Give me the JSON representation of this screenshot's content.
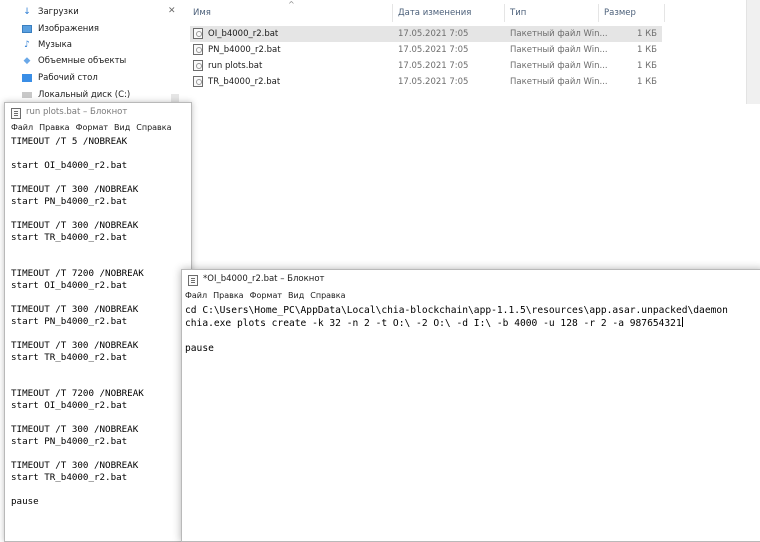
{
  "explorer": {
    "nav_items": [
      {
        "label": "Загрузки",
        "icon": "download-arrow-icon"
      },
      {
        "label": "Изображения",
        "icon": "pictures-icon"
      },
      {
        "label": "Музыка",
        "icon": "music-note-icon"
      },
      {
        "label": "Объемные объекты",
        "icon": "3d-objects-icon"
      },
      {
        "label": "Рабочий стол",
        "icon": "desktop-icon"
      },
      {
        "label": "Локальный диск (C:)",
        "icon": "drive-icon"
      }
    ],
    "columns": {
      "name": "Имя",
      "date": "Дата изменения",
      "type": "Тип",
      "size": "Размер"
    },
    "files": [
      {
        "name": "OI_b4000_r2.bat",
        "date": "17.05.2021 7:05",
        "type": "Пакетный файл Win...",
        "size": "1 КБ",
        "selected": true
      },
      {
        "name": "PN_b4000_r2.bat",
        "date": "17.05.2021 7:05",
        "type": "Пакетный файл Win...",
        "size": "1 КБ",
        "selected": false
      },
      {
        "name": "run plots.bat",
        "date": "17.05.2021 7:05",
        "type": "Пакетный файл Win...",
        "size": "1 КБ",
        "selected": false
      },
      {
        "name": "TR_b4000_r2.bat",
        "date": "17.05.2021 7:05",
        "type": "Пакетный файл Win...",
        "size": "1 КБ",
        "selected": false
      }
    ]
  },
  "notepad_menu": [
    "Файл",
    "Правка",
    "Формат",
    "Вид",
    "Справка"
  ],
  "notepad1": {
    "title": "run plots.bat – Блокнот",
    "lines": [
      "TIMEOUT /T 5 /NOBREAK",
      "",
      "start OI_b4000_r2.bat",
      "",
      "TIMEOUT /T 300 /NOBREAK",
      "start PN_b4000_r2.bat",
      "",
      "TIMEOUT /T 300 /NOBREAK",
      "start TR_b4000_r2.bat",
      "",
      "",
      "TIMEOUT /T 7200 /NOBREAK",
      "start OI_b4000_r2.bat",
      "",
      "TIMEOUT /T 300 /NOBREAK",
      "start PN_b4000_r2.bat",
      "",
      "TIMEOUT /T 300 /NOBREAK",
      "start TR_b4000_r2.bat",
      "",
      "",
      "TIMEOUT /T 7200 /NOBREAK",
      "start OI_b4000_r2.bat",
      "",
      "TIMEOUT /T 300 /NOBREAK",
      "start PN_b4000_r2.bat",
      "",
      "TIMEOUT /T 300 /NOBREAK",
      "start TR_b4000_r2.bat",
      "",
      "pause"
    ]
  },
  "notepad2": {
    "title": "*OI_b4000_r2.bat – Блокнот",
    "lines": [
      "cd C:\\Users\\Home_PC\\AppData\\Local\\chia-blockchain\\app-1.1.5\\resources\\app.asar.unpacked\\daemon",
      "chia.exe plots create -k 32 -n 2 -t O:\\ -2 O:\\ -d I:\\ -b 4000 -u 128 -r 2 -a 987654321",
      "",
      "pause"
    ]
  }
}
